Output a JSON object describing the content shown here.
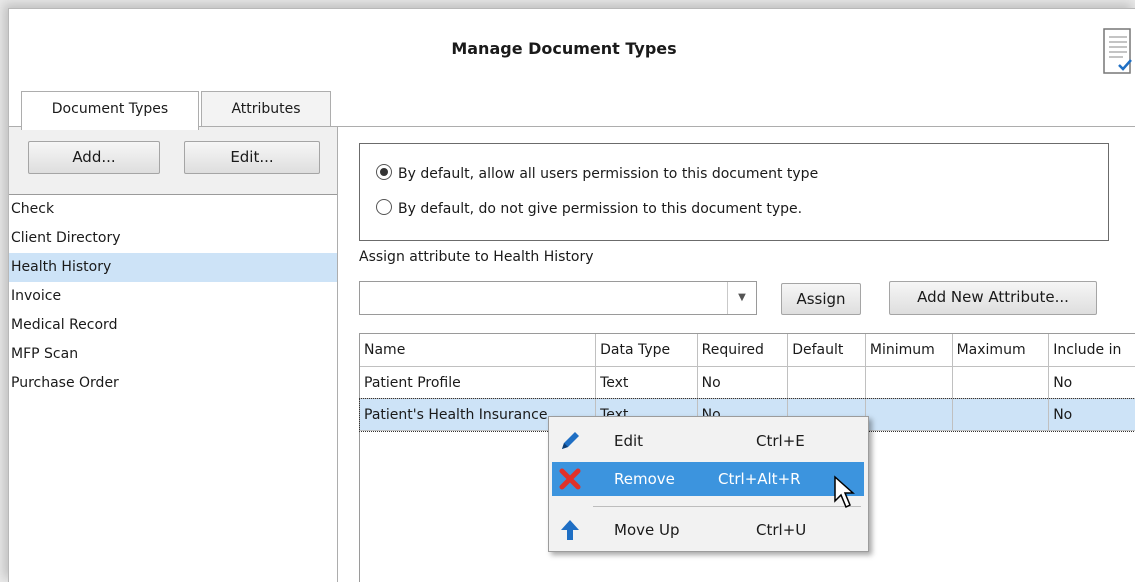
{
  "window": {
    "title": "Manage Document Types"
  },
  "tabs": [
    {
      "label": "Document Types",
      "active": true
    },
    {
      "label": "Attributes",
      "active": false
    }
  ],
  "left": {
    "add_label": "Add...",
    "edit_label": "Edit...",
    "document_types": [
      "Check",
      "Client Directory",
      "Health History",
      "Invoice",
      "Medical Record",
      "MFP Scan",
      "Purchase Order"
    ],
    "selected": "Health History"
  },
  "permissions": {
    "allow_label": "By default, allow all users permission to this document type",
    "deny_label": "By default, do not give permission to this document type.",
    "selected": "allow"
  },
  "assign": {
    "label": "Assign attribute to Health History",
    "combo_value": "",
    "assign_button": "Assign",
    "add_new_button": "Add New Attribute..."
  },
  "grid": {
    "columns": [
      "Name",
      "Data Type",
      "Required",
      "Default",
      "Minimum",
      "Maximum",
      "Include in"
    ],
    "rows": [
      [
        "Patient Profile",
        "Text",
        "No",
        "",
        "",
        "",
        "No"
      ],
      [
        "Patient's Health Insurance",
        "Text",
        "No",
        "",
        "",
        "",
        "No"
      ]
    ],
    "selected_row": 1
  },
  "context_menu": {
    "items": [
      {
        "label": "Edit",
        "shortcut": "Ctrl+E",
        "icon": "pencil-icon"
      },
      {
        "label": "Remove",
        "shortcut": "Ctrl+Alt+R",
        "icon": "red-x-icon",
        "highlighted": true
      },
      {
        "label": "Move Up",
        "shortcut": "Ctrl+U",
        "icon": "up-arrow-icon"
      }
    ]
  },
  "colors": {
    "selection": "#cde3f7",
    "menu_highlight": "#3c94de",
    "remove_icon": "#e0312a",
    "icon_blue": "#1f6fc4"
  }
}
